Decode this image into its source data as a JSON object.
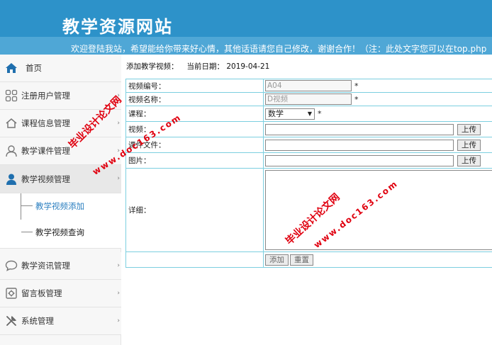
{
  "header": {
    "title": "教学资源网站",
    "welcome": "欢迎登陆我站，希望能给你带来好心情，其他话语请您自己修改，谢谢合作！（注：此处文字您可以在top.php"
  },
  "sidebar": {
    "items": [
      {
        "label": "首页",
        "icon": "home-icon"
      },
      {
        "label": "注册用户管理",
        "icon": "grid-icon"
      },
      {
        "label": "课程信息管理",
        "icon": "house-outline-icon"
      },
      {
        "label": "教学课件管理",
        "icon": "user-outline-icon"
      },
      {
        "label": "教学视频管理",
        "icon": "user-filled-icon"
      },
      {
        "label": "教学资讯管理",
        "icon": "chat-icon"
      },
      {
        "label": "留言板管理",
        "icon": "gear-icon"
      },
      {
        "label": "系统管理",
        "icon": "tools-icon"
      }
    ],
    "subitems": [
      {
        "label": "教学视频添加"
      },
      {
        "label": "教学视频查询"
      }
    ]
  },
  "main": {
    "crumb": "添加教学视频：",
    "date": "当前日期：  2019-04-21",
    "form": {
      "code_label": "视频编号：",
      "code_value": "A04",
      "name_label": "视频名称：",
      "name_value": "D视频",
      "course_label": "课程：",
      "course_value": "数学",
      "video_label": "视频：",
      "courseware_label": "课件文件：",
      "image_label": "图片：",
      "detail_label": "详细：",
      "required": "*",
      "upload": "上传",
      "add": "添加",
      "reset": "重置"
    }
  },
  "watermark": {
    "a": "毕业设计论文网",
    "b": "www.doc163.com"
  },
  "colors": {
    "header": "#2d92c9",
    "header_band": "#4fa7d6",
    "table_border": "#7ccfe0",
    "active_sub": "#2b7fc0",
    "watermark": "#e0000f"
  }
}
